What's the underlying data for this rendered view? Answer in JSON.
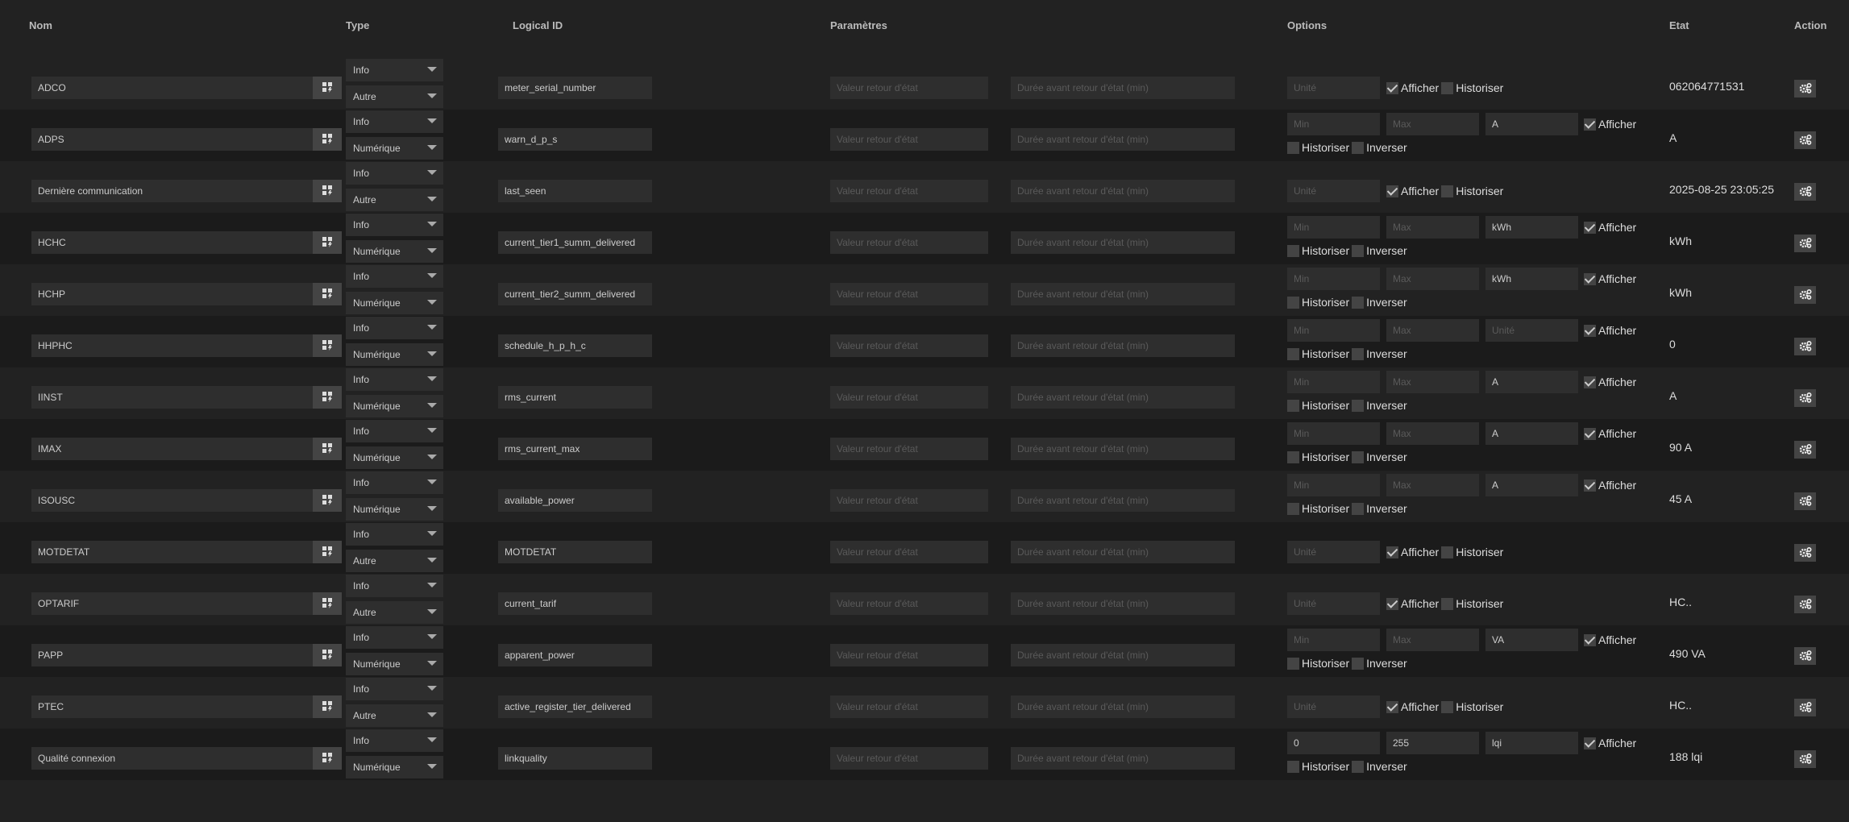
{
  "headers": {
    "nom": "Nom",
    "type": "Type",
    "logical_id": "Logical ID",
    "parametres": "Paramètres",
    "options": "Options",
    "etat": "Etat",
    "action": "Action"
  },
  "placeholders": {
    "valeur_retour": "Valeur retour d'état",
    "duree_retour": "Durée avant retour d'état (min)",
    "unite": "Unité",
    "min": "Min",
    "max": "Max"
  },
  "labels": {
    "afficher": "Afficher",
    "historiser": "Historiser",
    "inverser": "Inverser"
  },
  "rows": [
    {
      "name": "ADCO",
      "type": "Info",
      "subtype": "Autre",
      "logical_id": "meter_serial_number",
      "numeric": false,
      "min": "",
      "max": "",
      "unit": "",
      "afficher": true,
      "historiser": false,
      "inverser": false,
      "etat": "062064771531"
    },
    {
      "name": "ADPS",
      "type": "Info",
      "subtype": "Numérique",
      "logical_id": "warn_d_p_s",
      "numeric": true,
      "min": "",
      "max": "",
      "unit": "A",
      "afficher": true,
      "historiser": false,
      "inverser": false,
      "etat": "A"
    },
    {
      "name": "Dernière communication",
      "type": "Info",
      "subtype": "Autre",
      "logical_id": "last_seen",
      "numeric": false,
      "min": "",
      "max": "",
      "unit": "",
      "afficher": true,
      "historiser": false,
      "inverser": false,
      "etat": "2025-08-25 23:05:25"
    },
    {
      "name": "HCHC",
      "type": "Info",
      "subtype": "Numérique",
      "logical_id": "current_tier1_summ_delivered",
      "numeric": true,
      "min": "",
      "max": "",
      "unit": "kWh",
      "afficher": true,
      "historiser": false,
      "inverser": false,
      "etat": "kWh"
    },
    {
      "name": "HCHP",
      "type": "Info",
      "subtype": "Numérique",
      "logical_id": "current_tier2_summ_delivered",
      "numeric": true,
      "min": "",
      "max": "",
      "unit": "kWh",
      "afficher": true,
      "historiser": false,
      "inverser": false,
      "etat": "kWh"
    },
    {
      "name": "HHPHC",
      "type": "Info",
      "subtype": "Numérique",
      "logical_id": "schedule_h_p_h_c",
      "numeric": true,
      "min": "",
      "max": "",
      "unit": "",
      "afficher": true,
      "historiser": false,
      "inverser": false,
      "etat": "0"
    },
    {
      "name": "IINST",
      "type": "Info",
      "subtype": "Numérique",
      "logical_id": "rms_current",
      "numeric": true,
      "min": "",
      "max": "",
      "unit": "A",
      "afficher": true,
      "historiser": false,
      "inverser": false,
      "etat": "A"
    },
    {
      "name": "IMAX",
      "type": "Info",
      "subtype": "Numérique",
      "logical_id": "rms_current_max",
      "numeric": true,
      "min": "",
      "max": "",
      "unit": "A",
      "afficher": true,
      "historiser": false,
      "inverser": false,
      "etat": "90 A"
    },
    {
      "name": "ISOUSC",
      "type": "Info",
      "subtype": "Numérique",
      "logical_id": "available_power",
      "numeric": true,
      "min": "",
      "max": "",
      "unit": "A",
      "afficher": true,
      "historiser": false,
      "inverser": false,
      "etat": "45 A"
    },
    {
      "name": "MOTDETAT",
      "type": "Info",
      "subtype": "Autre",
      "logical_id": "MOTDETAT",
      "numeric": false,
      "min": "",
      "max": "",
      "unit": "",
      "afficher": true,
      "historiser": false,
      "inverser": false,
      "etat": ""
    },
    {
      "name": "OPTARIF",
      "type": "Info",
      "subtype": "Autre",
      "logical_id": "current_tarif",
      "numeric": false,
      "min": "",
      "max": "",
      "unit": "",
      "afficher": true,
      "historiser": false,
      "inverser": false,
      "etat": "HC.."
    },
    {
      "name": "PAPP",
      "type": "Info",
      "subtype": "Numérique",
      "logical_id": "apparent_power",
      "numeric": true,
      "min": "",
      "max": "",
      "unit": "VA",
      "afficher": true,
      "historiser": false,
      "inverser": false,
      "etat": "490 VA"
    },
    {
      "name": "PTEC",
      "type": "Info",
      "subtype": "Autre",
      "logical_id": "active_register_tier_delivered",
      "numeric": false,
      "min": "",
      "max": "",
      "unit": "",
      "afficher": true,
      "historiser": false,
      "inverser": false,
      "etat": "HC.."
    },
    {
      "name": "Qualité connexion",
      "type": "Info",
      "subtype": "Numérique",
      "logical_id": "linkquality",
      "numeric": true,
      "min": "0",
      "max": "255",
      "unit": "lqi",
      "afficher": true,
      "historiser": false,
      "inverser": false,
      "etat": "188 lqi"
    }
  ]
}
